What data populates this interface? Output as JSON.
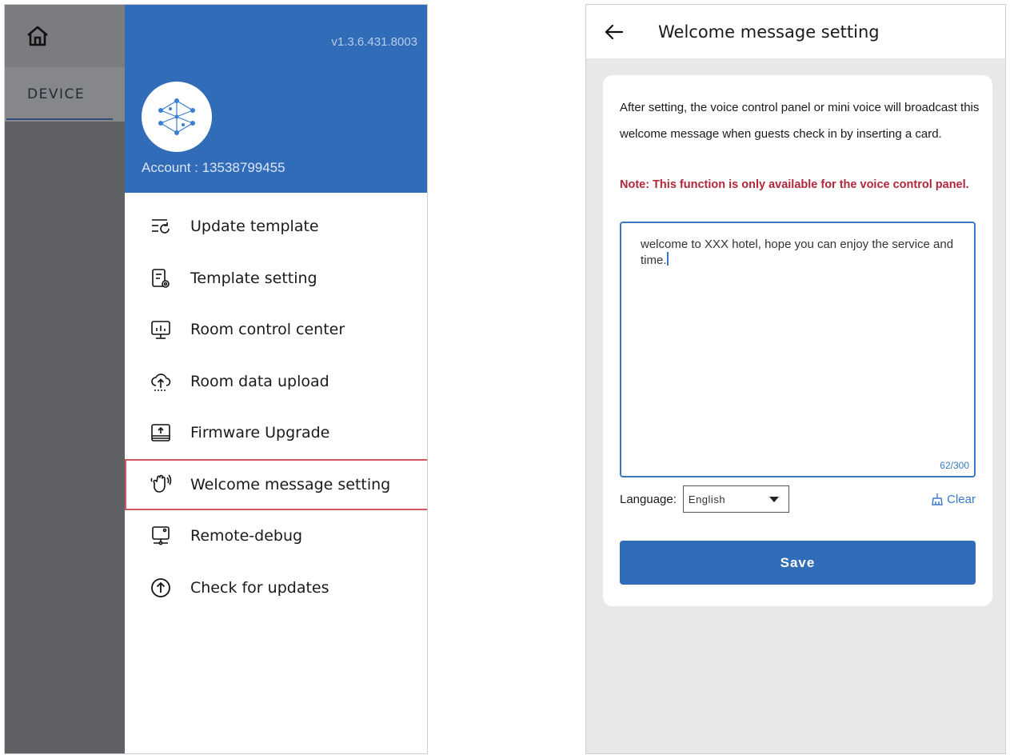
{
  "left_panel": {
    "rail": {
      "home_icon": "home-icon",
      "device_label": "DEVICE"
    },
    "drawer": {
      "version": "v1.3.6.431.8003",
      "avatar_icon": "network-hub-icon",
      "account": "Account : 13538799455",
      "menu": [
        {
          "label": "Update template",
          "icon": "update-template-icon"
        },
        {
          "label": "Template setting",
          "icon": "template-setting-icon"
        },
        {
          "label": "Room control center",
          "icon": "monitor-chart-icon"
        },
        {
          "label": "Room data upload",
          "icon": "cloud-upload-icon"
        },
        {
          "label": "Firmware Upgrade",
          "icon": "firmware-upgrade-icon"
        },
        {
          "label": "Welcome message setting",
          "icon": "wave-hand-icon",
          "selected": true
        },
        {
          "label": "Remote-debug",
          "icon": "remote-debug-icon"
        },
        {
          "label": "Check for updates",
          "icon": "arrow-up-circle-icon"
        }
      ]
    }
  },
  "right_panel": {
    "header": {
      "back_icon": "back-arrow-icon",
      "title": "Welcome message setting"
    },
    "description": "After setting, the voice control panel or mini voice will broadcast this welcome message when guests check in by inserting a card.",
    "note": "Note: This function is only available for the voice control panel.",
    "message": {
      "value": "welcome to XXX hotel, hope you can enjoy the service and time.",
      "counter": "62/300"
    },
    "language": {
      "label": "Language:",
      "selected": "English"
    },
    "clear_label": "Clear",
    "save_label": "Save"
  },
  "colors": {
    "brand_blue": "#316cb8",
    "note_red": "#b0283a",
    "selection_outline": "#d0575f",
    "rail_gray": "#5f6164"
  }
}
